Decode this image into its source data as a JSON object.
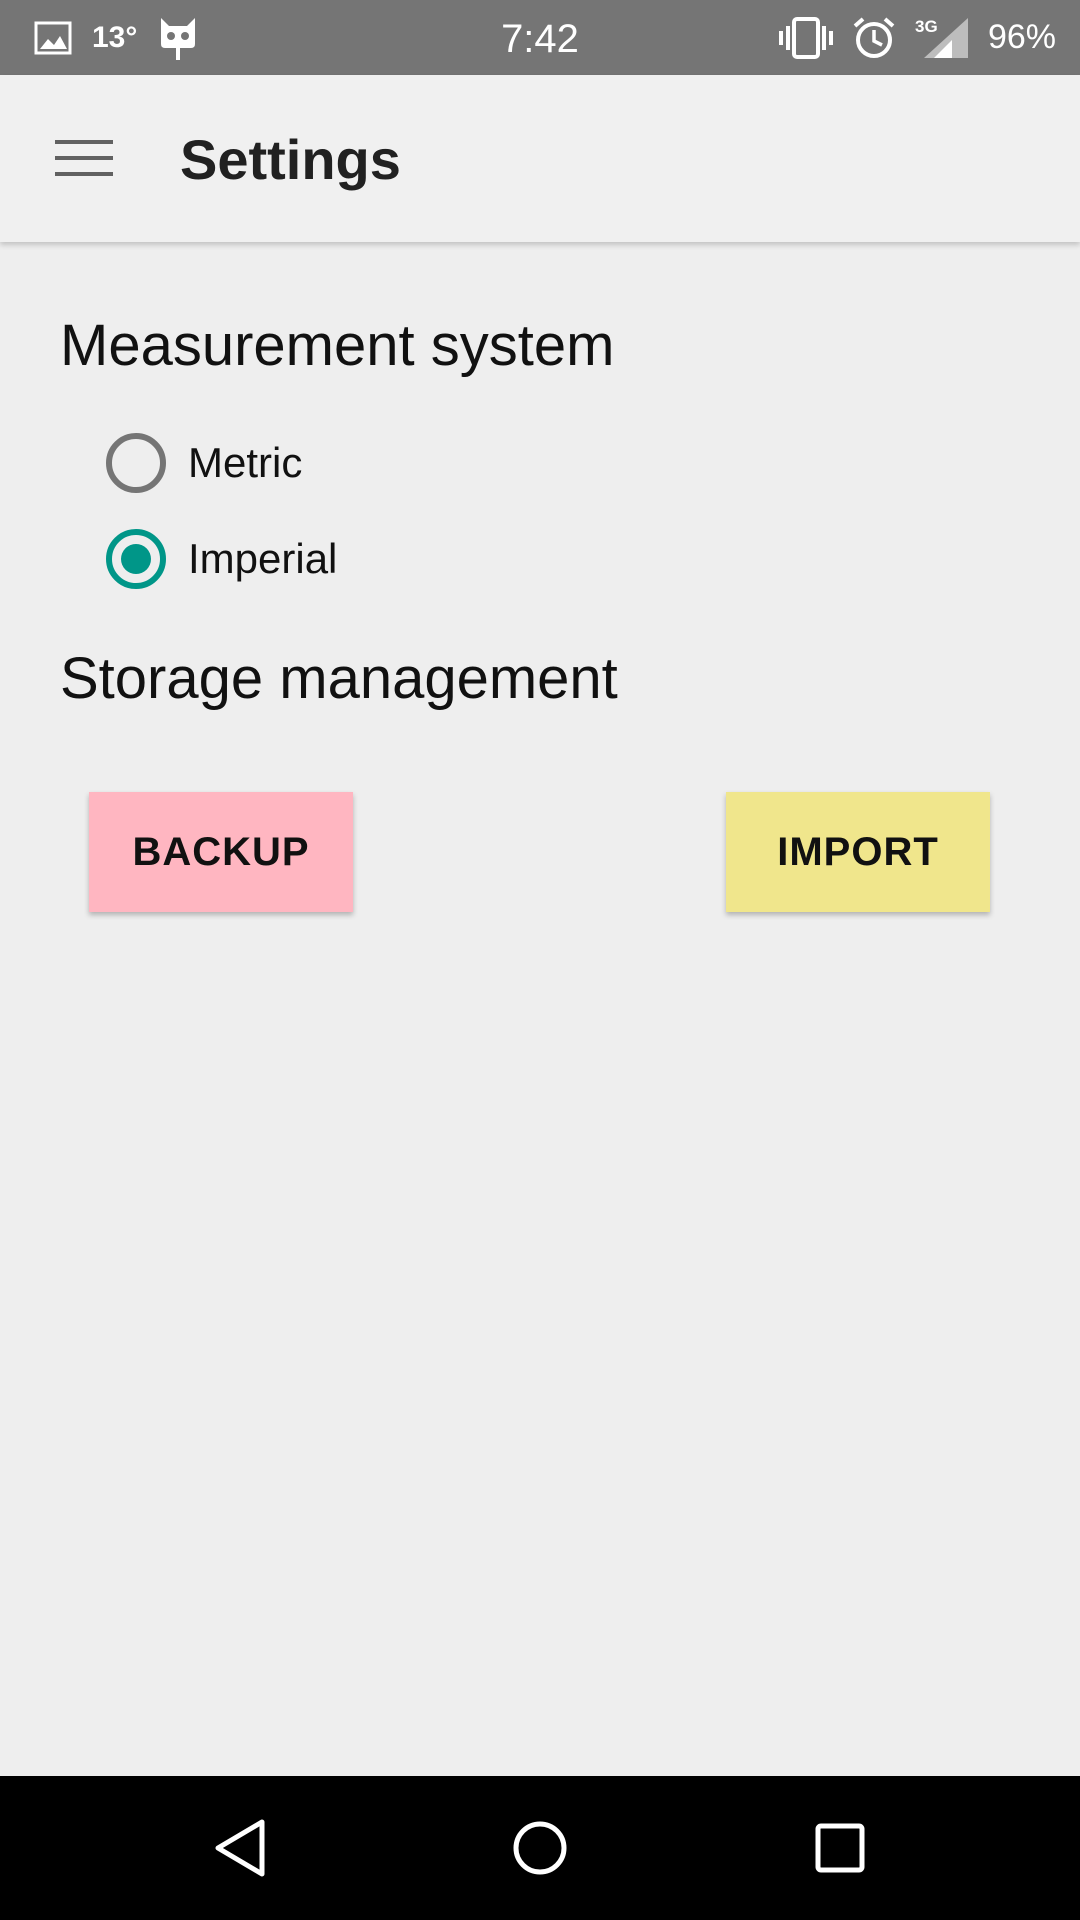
{
  "status_bar": {
    "temperature": "13°",
    "time": "7:42",
    "network": "3G",
    "battery": "96%",
    "icons": [
      "image-icon",
      "cyanogen-icon",
      "vibrate-icon",
      "alarm-icon",
      "signal-icon"
    ]
  },
  "app_bar": {
    "menu_icon": "hamburger-menu-icon",
    "title": "Settings"
  },
  "measurement": {
    "heading": "Measurement system",
    "options": [
      {
        "label": "Metric",
        "selected": false
      },
      {
        "label": "Imperial",
        "selected": true
      }
    ]
  },
  "storage": {
    "heading": "Storage management",
    "backup_label": "BACKUP",
    "import_label": "IMPORT"
  },
  "colors": {
    "accent": "#009688",
    "backup_button": "#ffb6c1",
    "import_button": "#f0e68c",
    "status_bar": "#757575",
    "app_bar": "#f0f0f0",
    "background": "#eeeeee"
  },
  "nav_bar": {
    "buttons": [
      "back-icon",
      "home-icon",
      "recents-icon"
    ]
  }
}
